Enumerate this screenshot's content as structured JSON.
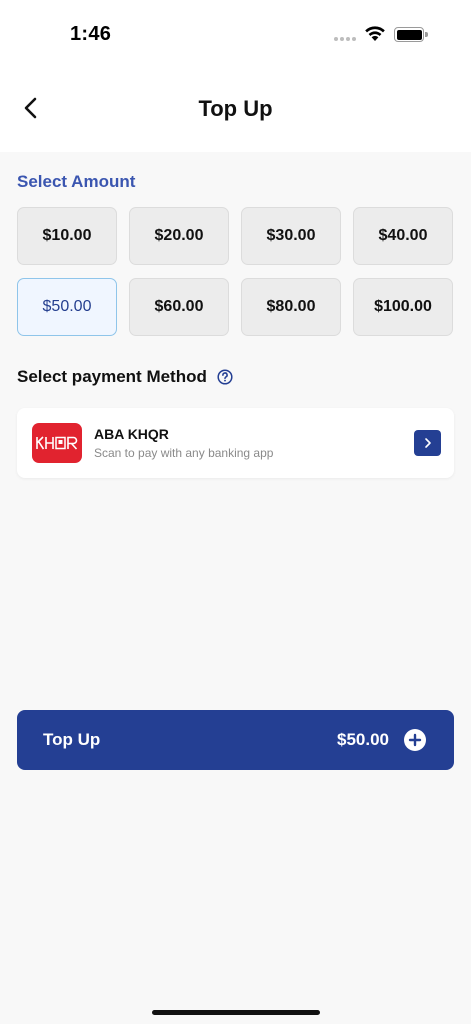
{
  "status_bar": {
    "time": "1:46"
  },
  "header": {
    "title": "Top Up"
  },
  "amount_section": {
    "title": "Select Amount",
    "amounts": [
      "$10.00",
      "$20.00",
      "$30.00",
      "$40.00",
      "$50.00",
      "$60.00",
      "$80.00",
      "$100.00"
    ],
    "selected_index": 4
  },
  "payment_section": {
    "title": "Select payment Method",
    "methods": [
      {
        "name": "ABA KHQR",
        "description": "Scan to pay with any banking app",
        "logo_icon": "khqr-logo"
      }
    ]
  },
  "topup_button": {
    "label": "Top Up",
    "amount": "$50.00"
  },
  "colors": {
    "primary": "#243f93",
    "accent_blue_text": "#3b56b0",
    "khqr_red": "#e1232f",
    "selected_bg": "#f0f6ff",
    "selected_border": "#8fc5ea"
  }
}
